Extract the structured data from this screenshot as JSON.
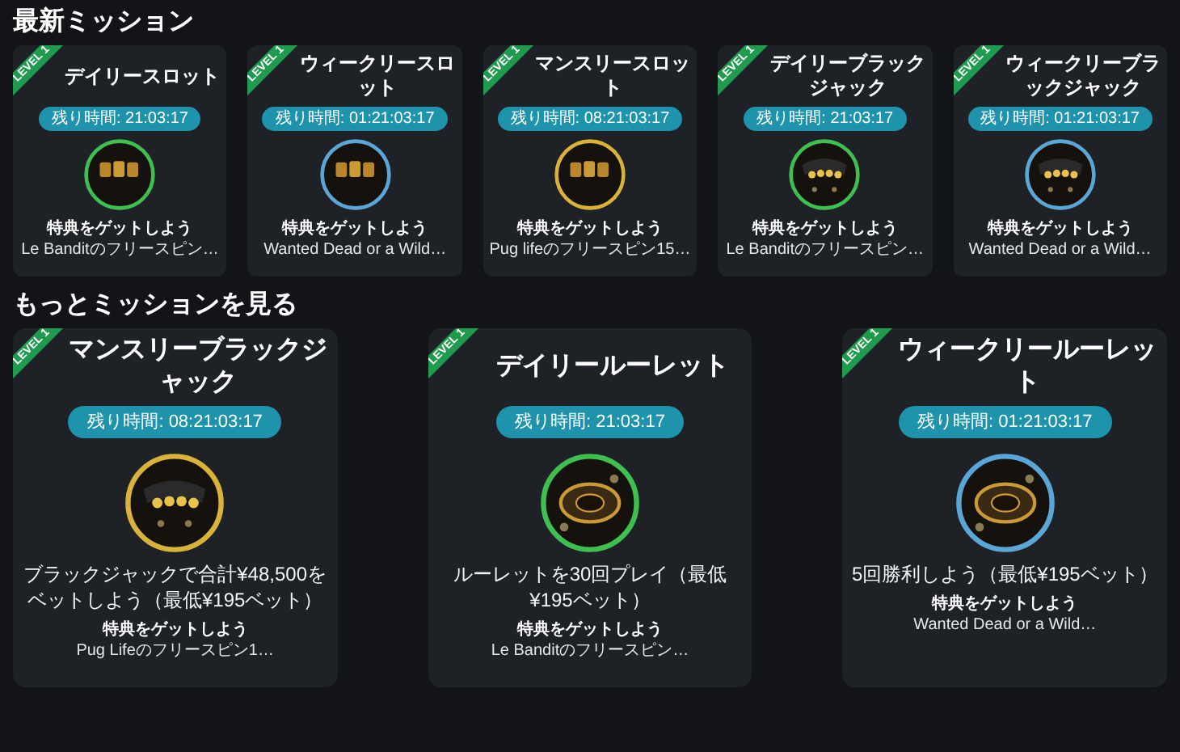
{
  "sections": [
    {
      "heading": "最新ミッション",
      "missions": [
        {
          "ribbon": "LEVEL 1",
          "title": "デイリースロット",
          "timer": "残り時間: 21:03:17",
          "kind": "slot",
          "color": "#3fbf4f",
          "reward_label": "特典をゲットしよう",
          "reward": "Le Banditのフリースピン…"
        },
        {
          "ribbon": "LEVEL 1",
          "title": "ウィークリースロット",
          "timer": "残り時間: 01:21:03:17",
          "kind": "slot",
          "color": "#5aa6d6",
          "reward_label": "特典をゲットしよう",
          "reward": "Wanted Dead or a Wild…"
        },
        {
          "ribbon": "LEVEL 1",
          "title": "マンスリースロット",
          "timer": "残り時間: 08:21:03:17",
          "kind": "slot",
          "color": "#d9b23a",
          "reward_label": "特典をゲットしよう",
          "reward": "Pug lifeのフリースピン15…"
        },
        {
          "ribbon": "LEVEL 1",
          "title": "デイリーブラックジャック",
          "timer": "残り時間: 21:03:17",
          "kind": "blackjack",
          "color": "#3fbf4f",
          "reward_label": "特典をゲットしよう",
          "reward": "Le Banditのフリースピン…"
        },
        {
          "ribbon": "LEVEL 1",
          "title": "ウィークリーブラックジャック",
          "timer": "残り時間: 01:21:03:17",
          "kind": "blackjack",
          "color": "#5aa6d6",
          "reward_label": "特典をゲットしよう",
          "reward": "Wanted Dead or a Wild…"
        }
      ]
    },
    {
      "heading": "もっとミッションを見る",
      "missions": [
        {
          "ribbon": "LEVEL 1",
          "title": "マンスリーブラックジャック",
          "timer": "残り時間: 08:21:03:17",
          "kind": "blackjack",
          "color": "#d9b23a",
          "description": "ブラックジャックで合計¥48,500をベットしよう（最低¥195ベット）",
          "reward_label": "特典をゲットしよう",
          "reward": "Pug Lifeのフリースピン1…"
        },
        {
          "ribbon": "LEVEL 1",
          "title": "デイリールーレット",
          "timer": "残り時間: 21:03:17",
          "kind": "roulette",
          "color": "#3fbf4f",
          "description": "ルーレットを30回プレイ（最低¥195ベット）",
          "reward_label": "特典をゲットしよう",
          "reward": "Le Banditのフリースピン…"
        },
        {
          "ribbon": "LEVEL 1",
          "title": "ウィークリールーレット",
          "timer": "残り時間: 01:21:03:17",
          "kind": "roulette",
          "color": "#5aa6d6",
          "description": "5回勝利しよう（最低¥195ベット）",
          "reward_label": "特典をゲットしよう",
          "reward": "Wanted Dead or a Wild…"
        }
      ]
    }
  ]
}
